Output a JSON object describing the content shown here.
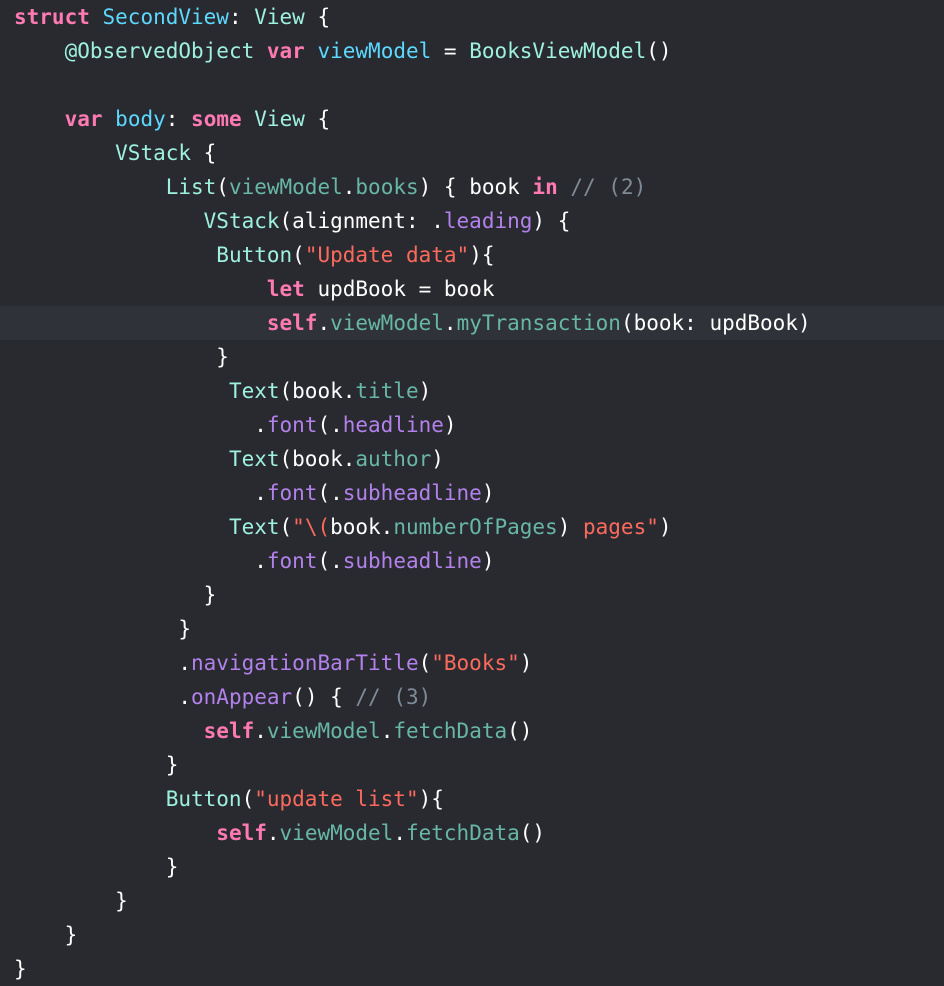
{
  "editor": {
    "theme": {
      "background": "#292a30",
      "current_line": "#2f3239",
      "keyword": "#ff7ab2",
      "type": "#9ef1dd",
      "declaration": "#5dd8ff",
      "property": "#67b7a4",
      "member": "#b281eb",
      "string": "#fc6a5d",
      "comment": "#7f8c98"
    },
    "current_line_index": 9,
    "lines": [
      [
        {
          "t": "kw",
          "v": "struct"
        },
        {
          "t": "pl",
          "v": " "
        },
        {
          "t": "tyd",
          "v": "SecondView"
        },
        {
          "t": "pl",
          "v": ": "
        },
        {
          "t": "ty",
          "v": "View"
        },
        {
          "t": "pl",
          "v": " {"
        }
      ],
      [
        {
          "t": "pl",
          "v": "    "
        },
        {
          "t": "ty",
          "v": "@ObservedObject"
        },
        {
          "t": "pl",
          "v": " "
        },
        {
          "t": "kw",
          "v": "var"
        },
        {
          "t": "pl",
          "v": " "
        },
        {
          "t": "tyd",
          "v": "viewModel"
        },
        {
          "t": "pl",
          "v": " = "
        },
        {
          "t": "ty",
          "v": "BooksViewModel"
        },
        {
          "t": "pl",
          "v": "()"
        }
      ],
      [],
      [
        {
          "t": "pl",
          "v": "    "
        },
        {
          "t": "kw",
          "v": "var"
        },
        {
          "t": "pl",
          "v": " "
        },
        {
          "t": "tyd",
          "v": "body"
        },
        {
          "t": "pl",
          "v": ": "
        },
        {
          "t": "kw",
          "v": "some"
        },
        {
          "t": "pl",
          "v": " "
        },
        {
          "t": "ty",
          "v": "View"
        },
        {
          "t": "pl",
          "v": " {"
        }
      ],
      [
        {
          "t": "pl",
          "v": "        "
        },
        {
          "t": "ty",
          "v": "VStack"
        },
        {
          "t": "pl",
          "v": " {"
        }
      ],
      [
        {
          "t": "pl",
          "v": "            "
        },
        {
          "t": "ty",
          "v": "List"
        },
        {
          "t": "pl",
          "v": "("
        },
        {
          "t": "prop",
          "v": "viewModel"
        },
        {
          "t": "pl",
          "v": "."
        },
        {
          "t": "prop",
          "v": "books"
        },
        {
          "t": "pl",
          "v": ") { book "
        },
        {
          "t": "kw",
          "v": "in"
        },
        {
          "t": "pl",
          "v": " "
        },
        {
          "t": "cm",
          "v": "// (2)"
        }
      ],
      [
        {
          "t": "pl",
          "v": "               "
        },
        {
          "t": "ty",
          "v": "VStack"
        },
        {
          "t": "pl",
          "v": "(alignment: ."
        },
        {
          "t": "fn",
          "v": "leading"
        },
        {
          "t": "pl",
          "v": ") {"
        }
      ],
      [
        {
          "t": "pl",
          "v": "                "
        },
        {
          "t": "ty",
          "v": "Button"
        },
        {
          "t": "pl",
          "v": "("
        },
        {
          "t": "str",
          "v": "\"Update data\""
        },
        {
          "t": "pl",
          "v": "){"
        }
      ],
      [
        {
          "t": "pl",
          "v": "                    "
        },
        {
          "t": "kw",
          "v": "let"
        },
        {
          "t": "pl",
          "v": " updBook = book"
        }
      ],
      [
        {
          "t": "pl",
          "v": "                    "
        },
        {
          "t": "kw",
          "v": "self"
        },
        {
          "t": "pl",
          "v": "."
        },
        {
          "t": "prop",
          "v": "viewModel"
        },
        {
          "t": "pl",
          "v": "."
        },
        {
          "t": "prop",
          "v": "myTransaction"
        },
        {
          "t": "pl",
          "v": "(book: updBook)"
        }
      ],
      [
        {
          "t": "pl",
          "v": "                }"
        }
      ],
      [
        {
          "t": "pl",
          "v": "                 "
        },
        {
          "t": "ty",
          "v": "Text"
        },
        {
          "t": "pl",
          "v": "(book."
        },
        {
          "t": "prop",
          "v": "title"
        },
        {
          "t": "pl",
          "v": ")"
        }
      ],
      [
        {
          "t": "pl",
          "v": "                   ."
        },
        {
          "t": "fn",
          "v": "font"
        },
        {
          "t": "pl",
          "v": "(."
        },
        {
          "t": "fn",
          "v": "headline"
        },
        {
          "t": "pl",
          "v": ")"
        }
      ],
      [
        {
          "t": "pl",
          "v": "                 "
        },
        {
          "t": "ty",
          "v": "Text"
        },
        {
          "t": "pl",
          "v": "(book."
        },
        {
          "t": "prop",
          "v": "author"
        },
        {
          "t": "pl",
          "v": ")"
        }
      ],
      [
        {
          "t": "pl",
          "v": "                   ."
        },
        {
          "t": "fn",
          "v": "font"
        },
        {
          "t": "pl",
          "v": "(."
        },
        {
          "t": "fn",
          "v": "subheadline"
        },
        {
          "t": "pl",
          "v": ")"
        }
      ],
      [
        {
          "t": "pl",
          "v": "                 "
        },
        {
          "t": "ty",
          "v": "Text"
        },
        {
          "t": "pl",
          "v": "("
        },
        {
          "t": "str",
          "v": "\"\\("
        },
        {
          "t": "pl",
          "v": "book."
        },
        {
          "t": "prop",
          "v": "numberOfPages"
        },
        {
          "t": "pl",
          "v": ")"
        },
        {
          "t": "str",
          "v": " pages\""
        },
        {
          "t": "pl",
          "v": ")"
        }
      ],
      [
        {
          "t": "pl",
          "v": "                   ."
        },
        {
          "t": "fn",
          "v": "font"
        },
        {
          "t": "pl",
          "v": "(."
        },
        {
          "t": "fn",
          "v": "subheadline"
        },
        {
          "t": "pl",
          "v": ")"
        }
      ],
      [
        {
          "t": "pl",
          "v": "               }"
        }
      ],
      [
        {
          "t": "pl",
          "v": "             }"
        }
      ],
      [
        {
          "t": "pl",
          "v": "             ."
        },
        {
          "t": "fn",
          "v": "navigationBarTitle"
        },
        {
          "t": "pl",
          "v": "("
        },
        {
          "t": "str",
          "v": "\"Books\""
        },
        {
          "t": "pl",
          "v": ")"
        }
      ],
      [
        {
          "t": "pl",
          "v": "             ."
        },
        {
          "t": "fn",
          "v": "onAppear"
        },
        {
          "t": "pl",
          "v": "() { "
        },
        {
          "t": "cm",
          "v": "// (3)"
        }
      ],
      [
        {
          "t": "pl",
          "v": "               "
        },
        {
          "t": "kw",
          "v": "self"
        },
        {
          "t": "pl",
          "v": "."
        },
        {
          "t": "prop",
          "v": "viewModel"
        },
        {
          "t": "pl",
          "v": "."
        },
        {
          "t": "prop",
          "v": "fetchData"
        },
        {
          "t": "pl",
          "v": "()"
        }
      ],
      [
        {
          "t": "pl",
          "v": "            }"
        }
      ],
      [
        {
          "t": "pl",
          "v": "            "
        },
        {
          "t": "ty",
          "v": "Button"
        },
        {
          "t": "pl",
          "v": "("
        },
        {
          "t": "str",
          "v": "\"update list\""
        },
        {
          "t": "pl",
          "v": "){"
        }
      ],
      [
        {
          "t": "pl",
          "v": "                "
        },
        {
          "t": "kw",
          "v": "self"
        },
        {
          "t": "pl",
          "v": "."
        },
        {
          "t": "prop",
          "v": "viewModel"
        },
        {
          "t": "pl",
          "v": "."
        },
        {
          "t": "prop",
          "v": "fetchData"
        },
        {
          "t": "pl",
          "v": "()"
        }
      ],
      [
        {
          "t": "pl",
          "v": "            }"
        }
      ],
      [
        {
          "t": "pl",
          "v": "        }"
        }
      ],
      [
        {
          "t": "pl",
          "v": "    }"
        }
      ],
      [
        {
          "t": "pl",
          "v": "}"
        }
      ]
    ]
  }
}
